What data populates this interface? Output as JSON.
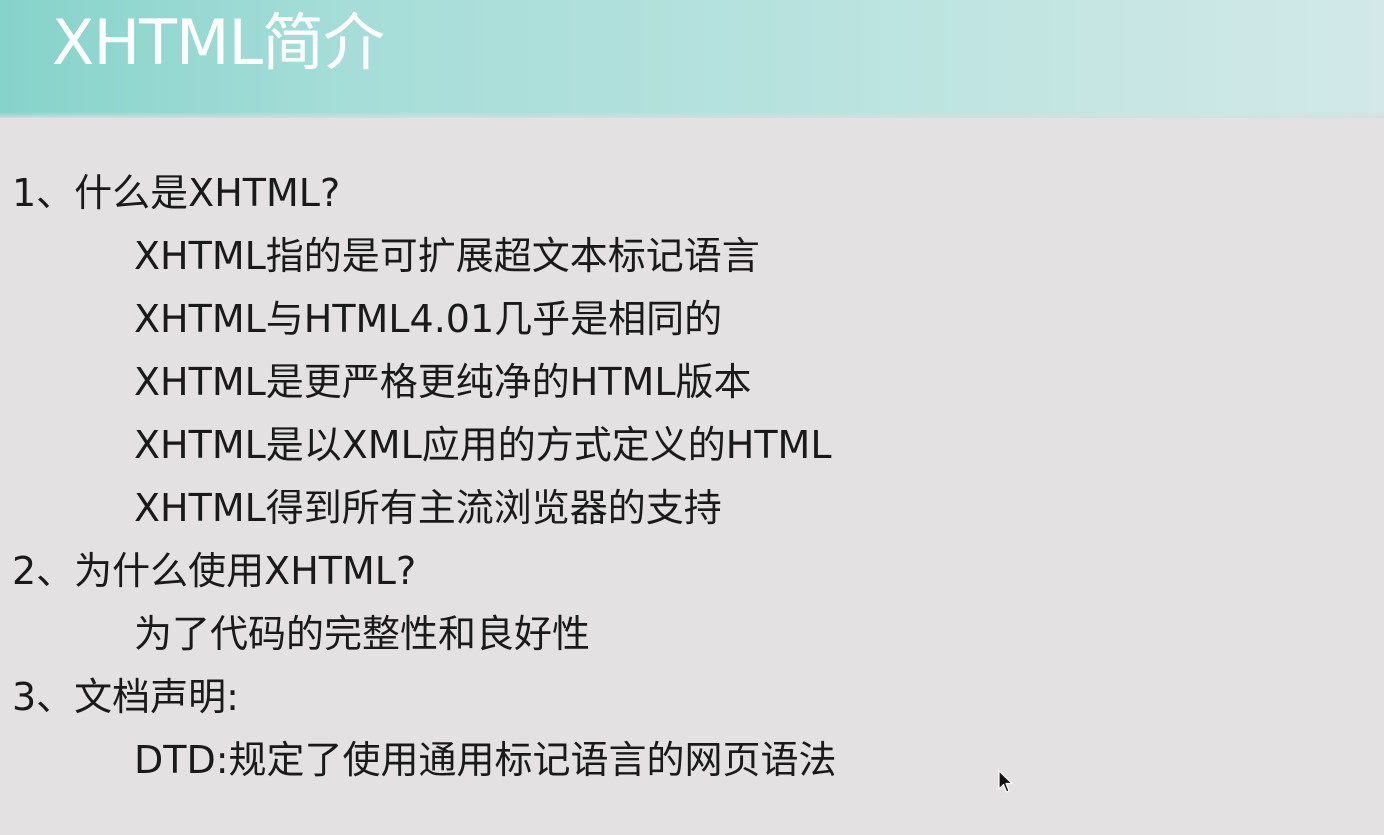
{
  "slide": {
    "title": "XHTML简介",
    "sections": [
      {
        "heading": "1、什么是XHTML?",
        "items": [
          "XHTML指的是可扩展超文本标记语言",
          "XHTML与HTML4.01几乎是相同的",
          "XHTML是更严格更纯净的HTML版本",
          "XHTML是以XML应用的方式定义的HTML",
          "XHTML得到所有主流浏览器的支持"
        ]
      },
      {
        "heading": "2、为什么使用XHTML?",
        "items": [
          "为了代码的完整性和良好性"
        ]
      },
      {
        "heading": "3、文档声明:",
        "items": [
          "DTD:规定了使用通用标记语言的网页语法"
        ]
      }
    ]
  },
  "colors": {
    "background": "#e3e1e2",
    "title_bar_start": "#86d3cb",
    "title_bar_end": "#d2e8e9",
    "title_text": "#ffffff",
    "body_text": "#1a1a1a"
  },
  "icons": {
    "cursor": "mouse-pointer-icon"
  }
}
